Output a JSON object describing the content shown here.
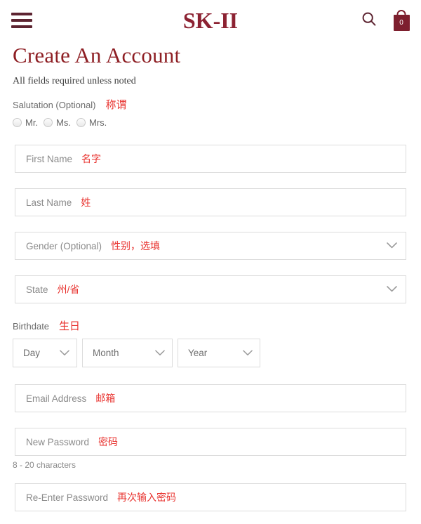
{
  "header": {
    "menu_icon": "hamburger-menu-icon",
    "logo_text": "SK-II",
    "search_icon": "search-icon",
    "cart_icon": "shopping-bag-icon",
    "cart_count": "0"
  },
  "page": {
    "title": "Create An Account",
    "subtitle": "All fields required unless noted"
  },
  "form": {
    "salutation": {
      "label": "Salutation (Optional)",
      "annotation_zh": "称谓",
      "options": [
        {
          "label": "Mr."
        },
        {
          "label": "Ms."
        },
        {
          "label": "Mrs."
        }
      ]
    },
    "first_name": {
      "placeholder": "First Name",
      "value": "",
      "annotation_zh": "名字"
    },
    "last_name": {
      "placeholder": "Last Name",
      "value": "",
      "annotation_zh": "姓"
    },
    "gender": {
      "placeholder": "Gender (Optional)",
      "value": "",
      "annotation_zh": "性别，选填",
      "chevron_icon": "chevron-down-icon"
    },
    "state": {
      "placeholder": "State",
      "value": "",
      "annotation_zh": "州/省",
      "chevron_icon": "chevron-down-icon"
    },
    "birthdate": {
      "label": "Birthdate",
      "annotation_zh": "生日",
      "day": {
        "placeholder": "Day",
        "chevron_icon": "chevron-down-icon"
      },
      "month": {
        "placeholder": "Month",
        "chevron_icon": "chevron-down-icon"
      },
      "year": {
        "placeholder": "Year",
        "chevron_icon": "chevron-down-icon"
      }
    },
    "email": {
      "placeholder": "Email Address",
      "value": "",
      "annotation_zh": "邮箱"
    },
    "new_password": {
      "placeholder": "New Password",
      "value": "",
      "annotation_zh": "密码",
      "helper": "8 - 20 characters"
    },
    "reenter_password": {
      "placeholder": "Re-Enter Password",
      "value": "",
      "annotation_zh": "再次输入密码"
    }
  },
  "colors": {
    "brand_red": "#8c2232",
    "title_red": "#8e1f24",
    "annotation_red": "#e8322e",
    "border_gray": "#dcdcdc",
    "placeholder_gray": "#8a8a8a"
  }
}
